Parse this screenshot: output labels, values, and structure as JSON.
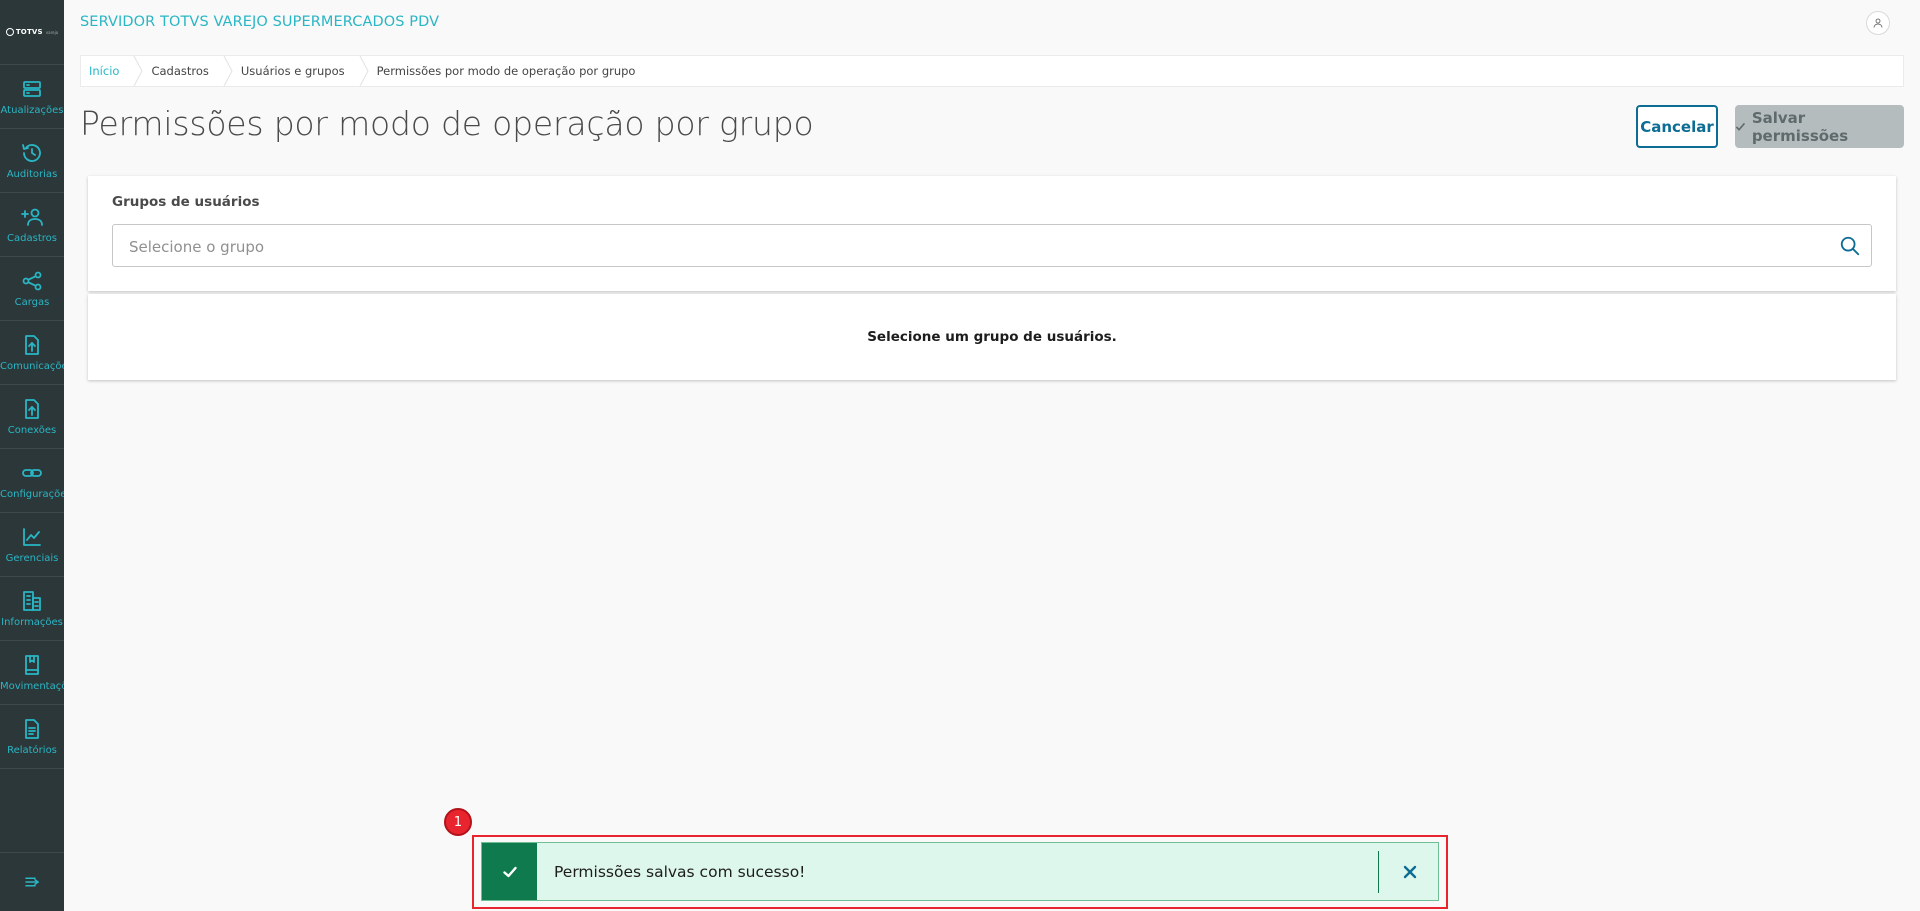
{
  "app": {
    "title": "SERVIDOR TOTVS VAREJO SUPERMERCADOS PDV",
    "logo_text": "TOTVS",
    "logo_sub": "varejo"
  },
  "sidebar": {
    "items": [
      {
        "label": "Atualizações",
        "icon": "server-icon"
      },
      {
        "label": "Auditorias",
        "icon": "history-icon"
      },
      {
        "label": "Cadastros",
        "icon": "user-add-icon"
      },
      {
        "label": "Cargas",
        "icon": "share-icon"
      },
      {
        "label": "Comunicações",
        "icon": "file-upload-icon"
      },
      {
        "label": "Conexões",
        "icon": "file-upload-icon"
      },
      {
        "label": "Configurações",
        "icon": "link-icon"
      },
      {
        "label": "Gerenciais",
        "icon": "chart-icon"
      },
      {
        "label": "Informações",
        "icon": "building-icon"
      },
      {
        "label": "Movimentações",
        "icon": "book-icon"
      },
      {
        "label": "Relatórios",
        "icon": "document-icon"
      }
    ],
    "collapse_icon": "menu-collapse-icon"
  },
  "breadcrumb": [
    {
      "label": "Início"
    },
    {
      "label": "Cadastros"
    },
    {
      "label": "Usuários e grupos"
    },
    {
      "label": "Permissões por modo de operação por grupo"
    }
  ],
  "page": {
    "title": "Permissões por modo de operação por grupo",
    "cancel_label": "Cancelar",
    "save_label": "Salvar permissões"
  },
  "groups": {
    "label": "Grupos de usuários",
    "placeholder": "Selecione o grupo",
    "value": ""
  },
  "empty_message": "Selecione um grupo de usuários.",
  "toast": {
    "message": "Permissões salvas com sucesso!",
    "marker": "1",
    "type": "success"
  },
  "colors": {
    "accent": "#29b6c5",
    "primary": "#0c6c94",
    "sidebar_bg": "#2c3739",
    "success": "#0f7a4d",
    "success_bg": "#def7ec",
    "highlight": "#e8252f"
  }
}
